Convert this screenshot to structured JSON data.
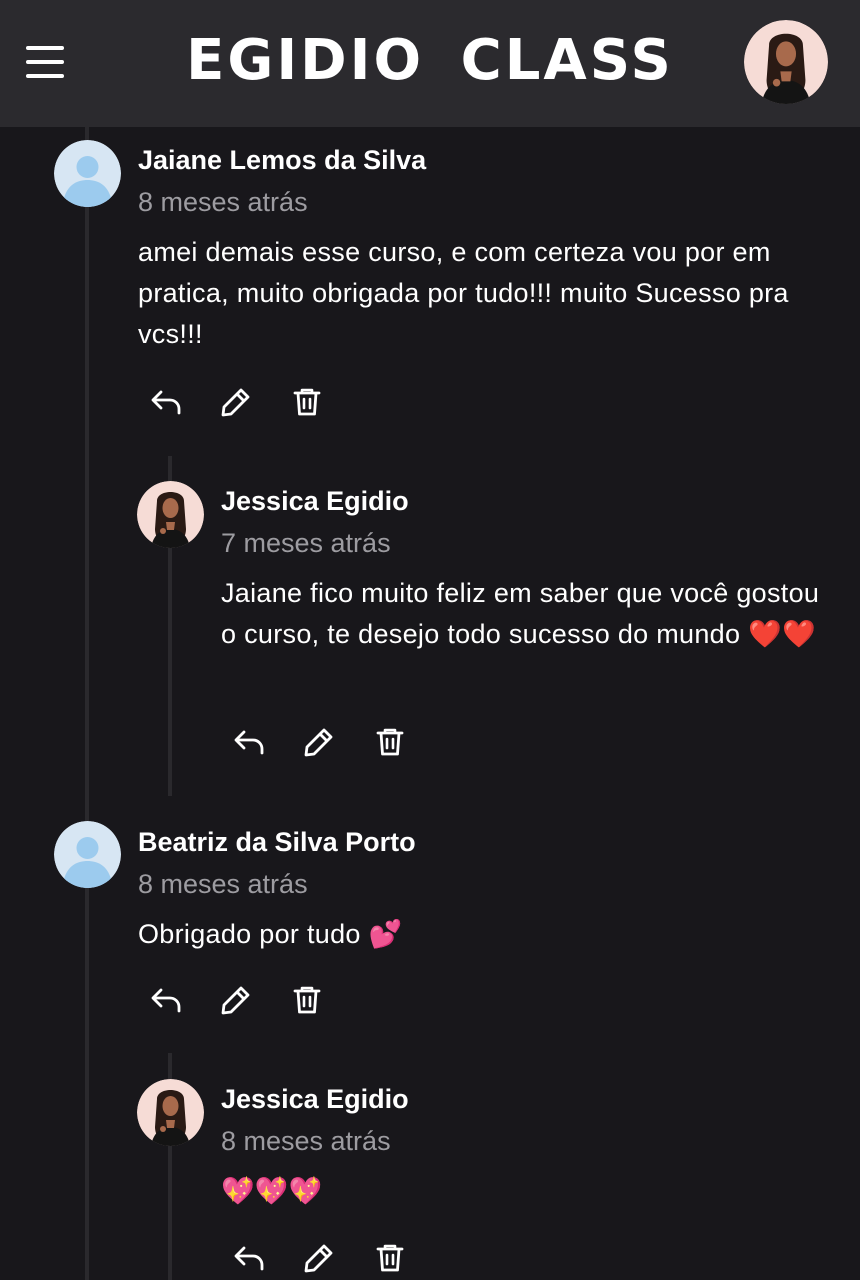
{
  "header": {
    "brand": "EGIDIO  CLASS",
    "menu_icon": "hamburger-menu-icon",
    "avatar_icon": "profile-avatar"
  },
  "comments": [
    {
      "author": "Jaiane Lemos da Silva",
      "time": "8 meses atrás",
      "text": "amei demais esse curso, e com certeza vou por em pratica, muito obrigada por tudo!!! muito Sucesso pra vcs!!!",
      "avatar": "default-user-avatar",
      "reply": {
        "author": "Jessica Egidio",
        "time": "7 meses atrás",
        "text": "Jaiane fico muito feliz em saber que você gostou o curso, te desejo todo sucesso do mundo ",
        "emoji": "❤️❤️",
        "avatar": "jessica-avatar"
      }
    },
    {
      "author": "Beatriz da Silva Porto",
      "time": "8 meses atrás",
      "text": "Obrigado por tudo ",
      "emoji": "💕",
      "avatar": "default-user-avatar",
      "reply": {
        "author": "Jessica Egidio",
        "time": "8 meses atrás",
        "text": "",
        "emoji": "💖💖💖",
        "avatar": "jessica-avatar"
      }
    }
  ],
  "actions": {
    "reply_icon": "reply-icon",
    "edit_icon": "edit-pencil-icon",
    "delete_icon": "trash-icon"
  },
  "colors": {
    "background": "#18171b",
    "header": "#2b2a2e",
    "muted_text": "#9d9ca1",
    "thread_line": "#2a292d",
    "default_avatar_bg": "#d7e6f3",
    "default_avatar_fg": "#9ccbee"
  }
}
